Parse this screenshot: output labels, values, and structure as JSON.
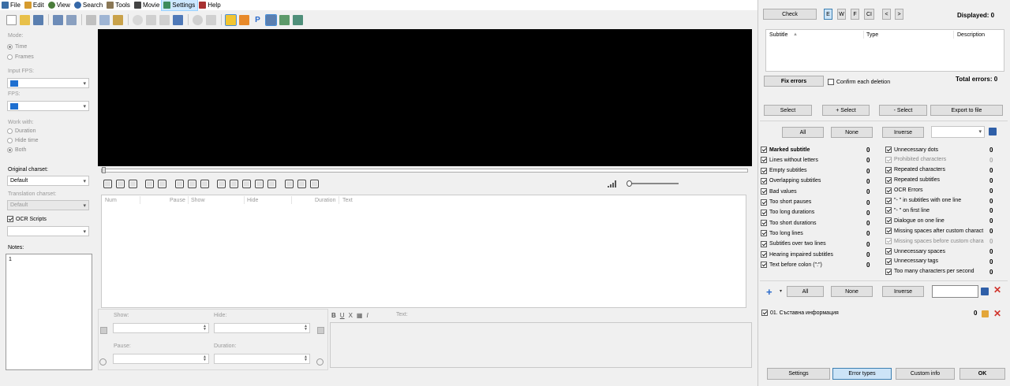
{
  "menu": [
    {
      "label": "File",
      "color": "#3a6ea5"
    },
    {
      "label": "Edit",
      "color": "#d69b2e"
    },
    {
      "label": "View",
      "color": "#4a7c3a"
    },
    {
      "label": "Search",
      "color": "#3568a8"
    },
    {
      "label": "Tools",
      "color": "#8a7755"
    },
    {
      "label": "Movie",
      "color": "#444444"
    },
    {
      "label": "Settings",
      "color": "#3d8c5c"
    },
    {
      "label": "Help",
      "color": "#a83232"
    }
  ],
  "left": {
    "mode_label": "Mode:",
    "mode_options": [
      {
        "label": "Time",
        "selected": true
      },
      {
        "label": "Frames",
        "selected": false
      }
    ],
    "input_fps_label": "Input FPS:",
    "fps_label": "FPS:",
    "work_with_label": "Work with:",
    "work_options": [
      {
        "label": "Duration",
        "selected": false
      },
      {
        "label": "Hide time",
        "selected": false
      },
      {
        "label": "Both",
        "selected": true
      }
    ],
    "original_charset_label": "Original charset:",
    "original_charset_value": "Default",
    "translation_charset_label": "Translation charset:",
    "translation_charset_value": "Default",
    "ocr_scripts_label": "OCR Scripts",
    "notes_label": "Notes:",
    "notes_value": "1"
  },
  "grid": {
    "headers": [
      "Num",
      "Pause",
      "Show",
      "Hide",
      "Duration",
      "Text"
    ]
  },
  "edit": {
    "show_label": "Show:",
    "hide_label": "Hide:",
    "pause_label": "Pause:",
    "duration_label": "Duration:",
    "text_label": "Text:",
    "format_buttons": [
      "B",
      "U",
      "X",
      "▦",
      "I"
    ]
  },
  "right": {
    "check_label": "Check",
    "mode_buttons": [
      "E",
      "W",
      "F",
      "CI",
      "<",
      ">"
    ],
    "displayed_label": "Displayed: 0",
    "table_headers": [
      "Subtitle",
      "Type",
      "Description"
    ],
    "fix_errors_label": "Fix errors",
    "confirm_label": "Confirm each deletion",
    "total_errors_label": "Total errors: 0",
    "action_buttons": [
      "Select",
      "+ Select",
      "- Select",
      "Export to file"
    ],
    "filter_buttons": [
      "All",
      "None",
      "Inverse"
    ],
    "errors_left": [
      {
        "label": "Marked subtitle",
        "count": "0",
        "checked": true,
        "bold": true,
        "dim": false
      },
      {
        "label": "Lines without letters",
        "count": "0",
        "checked": true,
        "bold": false,
        "dim": false
      },
      {
        "label": "Empty subtitles",
        "count": "0",
        "checked": true,
        "bold": false,
        "dim": false
      },
      {
        "label": "Overlapping subtitles",
        "count": "0",
        "checked": true,
        "bold": false,
        "dim": false
      },
      {
        "label": "Bad values",
        "count": "0",
        "checked": true,
        "bold": false,
        "dim": false
      },
      {
        "label": "Too short pauses",
        "count": "0",
        "checked": true,
        "bold": false,
        "dim": false
      },
      {
        "label": "Too long durations",
        "count": "0",
        "checked": true,
        "bold": false,
        "dim": false
      },
      {
        "label": "Too short durations",
        "count": "0",
        "checked": true,
        "bold": false,
        "dim": false
      },
      {
        "label": "Too long lines",
        "count": "0",
        "checked": true,
        "bold": false,
        "dim": false
      },
      {
        "label": "Subtitles over two lines",
        "count": "0",
        "checked": true,
        "bold": false,
        "dim": false
      },
      {
        "label": "Hearing impaired subtitles",
        "count": "0",
        "checked": true,
        "bold": false,
        "dim": false
      },
      {
        "label": "Text before colon (\":\")",
        "count": "0",
        "checked": true,
        "bold": false,
        "dim": false
      }
    ],
    "errors_right": [
      {
        "label": "Unnecessary dots",
        "count": "0",
        "checked": true,
        "dim": false
      },
      {
        "label": "Prohibited characters",
        "count": "0",
        "checked": true,
        "dim": true
      },
      {
        "label": "Repeated characters",
        "count": "0",
        "checked": true,
        "dim": false
      },
      {
        "label": "Repeated subtitles",
        "count": "0",
        "checked": true,
        "dim": false
      },
      {
        "label": "OCR Errors",
        "count": "0",
        "checked": true,
        "dim": false
      },
      {
        "label": "\"- \" in subtitles with one line",
        "count": "0",
        "checked": true,
        "dim": false
      },
      {
        "label": "\"- \" on first line",
        "count": "0",
        "checked": true,
        "dim": false
      },
      {
        "label": "Dialogue on one line",
        "count": "0",
        "checked": true,
        "dim": false
      },
      {
        "label": "Missing spaces after custom charact",
        "count": "0",
        "checked": true,
        "dim": false
      },
      {
        "label": "Missing spaces before custom chara",
        "count": "0",
        "checked": true,
        "dim": true
      },
      {
        "label": "Unnecessary spaces",
        "count": "0",
        "checked": true,
        "dim": false
      },
      {
        "label": "Unnecessary tags",
        "count": "0",
        "checked": true,
        "dim": false
      },
      {
        "label": "Too many characters per second",
        "count": "0",
        "checked": true,
        "dim": false
      }
    ],
    "custom_item": {
      "label": "01. Съставна информация",
      "count": "0",
      "checked": true
    },
    "bottom_buttons": [
      "Settings",
      "Error types",
      "Custom info",
      "OK"
    ]
  }
}
